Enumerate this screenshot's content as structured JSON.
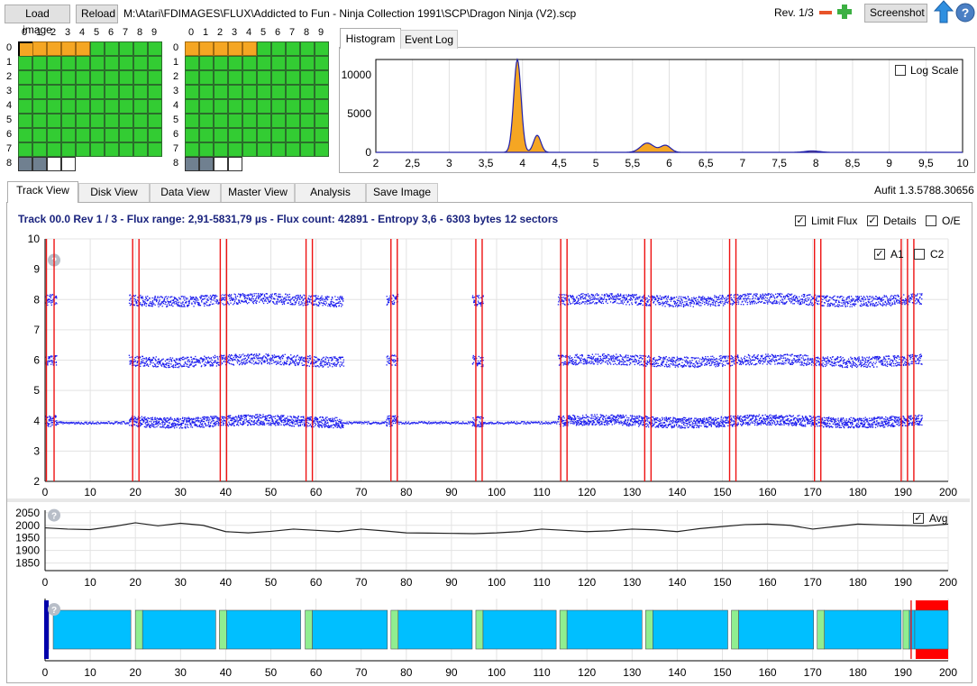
{
  "toolbar": {
    "load_label": "Load image",
    "reload_label": "Reload",
    "file_path": "M:\\Atari\\FDIMAGES\\FLUX\\Addicted to Fun - Ninja Collection 1991\\SCP\\Dragon Ninja (V2).scp",
    "rev_label": "Rev. 1/3",
    "minus_icon": "minus-icon",
    "plus_icon": "plus-icon",
    "screenshot_label": "Screenshot",
    "up_icon": "up-arrow-icon",
    "help_icon": "help-icon"
  },
  "track_grids": {
    "col_labels": [
      "0",
      "1",
      "2",
      "3",
      "4",
      "5",
      "6",
      "7",
      "8",
      "9"
    ],
    "row_labels": [
      "0",
      "1",
      "2",
      "3",
      "4",
      "5",
      "6",
      "7",
      "8"
    ],
    "colors": {
      "good": "#33cc33",
      "partial": "#f5a623",
      "unknown": "#708090",
      "empty": "#ffffff"
    },
    "side0": [
      [
        "partial",
        "partial",
        "partial",
        "partial",
        "partial",
        "good",
        "good",
        "good",
        "good",
        "good"
      ],
      [
        "good",
        "good",
        "good",
        "good",
        "good",
        "good",
        "good",
        "good",
        "good",
        "good"
      ],
      [
        "good",
        "good",
        "good",
        "good",
        "good",
        "good",
        "good",
        "good",
        "good",
        "good"
      ],
      [
        "good",
        "good",
        "good",
        "good",
        "good",
        "good",
        "good",
        "good",
        "good",
        "good"
      ],
      [
        "good",
        "good",
        "good",
        "good",
        "good",
        "good",
        "good",
        "good",
        "good",
        "good"
      ],
      [
        "good",
        "good",
        "good",
        "good",
        "good",
        "good",
        "good",
        "good",
        "good",
        "good"
      ],
      [
        "good",
        "good",
        "good",
        "good",
        "good",
        "good",
        "good",
        "good",
        "good",
        "good"
      ],
      [
        "good",
        "good",
        "good",
        "good",
        "good",
        "good",
        "good",
        "good",
        "good",
        "good"
      ],
      [
        "unknown",
        "unknown",
        "empty",
        "empty"
      ]
    ],
    "side1": [
      [
        "partial",
        "partial",
        "partial",
        "partial",
        "partial",
        "good",
        "good",
        "good",
        "good",
        "good"
      ],
      [
        "good",
        "good",
        "good",
        "good",
        "good",
        "good",
        "good",
        "good",
        "good",
        "good"
      ],
      [
        "good",
        "good",
        "good",
        "good",
        "good",
        "good",
        "good",
        "good",
        "good",
        "good"
      ],
      [
        "good",
        "good",
        "good",
        "good",
        "good",
        "good",
        "good",
        "good",
        "good",
        "good"
      ],
      [
        "good",
        "good",
        "good",
        "good",
        "good",
        "good",
        "good",
        "good",
        "good",
        "good"
      ],
      [
        "good",
        "good",
        "good",
        "good",
        "good",
        "good",
        "good",
        "good",
        "good",
        "good"
      ],
      [
        "good",
        "good",
        "good",
        "good",
        "good",
        "good",
        "good",
        "good",
        "good",
        "good"
      ],
      [
        "good",
        "good",
        "good",
        "good",
        "good",
        "good",
        "good",
        "good",
        "good",
        "good"
      ],
      [
        "unknown",
        "unknown",
        "empty",
        "empty"
      ]
    ]
  },
  "histogram_panel": {
    "tabs": [
      "Histogram",
      "Event Log"
    ],
    "log_scale_label": "Log Scale",
    "log_scale_checked": false
  },
  "main_tabs": [
    "Track View",
    "Disk View",
    "Data View",
    "Master View",
    "Analysis",
    "Save Image"
  ],
  "version": "Aufit 1.3.5788.30656",
  "track_info": "Track 00.0 Rev 1 / 3 - Flux range: 2,91-5831,79 µs - Flux count: 42891 - Entropy 3,6 - 6303 bytes 12 sectors",
  "options": {
    "limit_flux_label": "Limit Flux",
    "limit_flux_checked": true,
    "details_label": "Details",
    "details_checked": true,
    "oe_label": "O/E",
    "oe_checked": false,
    "a1_label": "A1",
    "a1_checked": true,
    "c2_label": "C2",
    "c2_checked": false,
    "avg_label": "Avg",
    "avg_checked": true
  },
  "chart_data": [
    {
      "type": "area",
      "name": "histogram",
      "x_ticks": [
        "2",
        "2,5",
        "3",
        "3,5",
        "4",
        "4,5",
        "5",
        "5,5",
        "6",
        "6,5",
        "7",
        "7,5",
        "8",
        "8,5",
        "9",
        "9,5",
        "10"
      ],
      "y_ticks": [
        "0",
        "5000",
        "10000"
      ],
      "xlim": [
        2,
        10
      ],
      "ylim": [
        0,
        12000
      ],
      "peaks": [
        {
          "x": 3.93,
          "y": 12000,
          "width": 0.05
        },
        {
          "x": 4.2,
          "y": 2200,
          "width": 0.05
        },
        {
          "x": 5.7,
          "y": 1200,
          "width": 0.09
        },
        {
          "x": 5.95,
          "y": 900,
          "width": 0.07
        },
        {
          "x": 7.95,
          "y": 180,
          "width": 0.1
        }
      ],
      "fill_color": "#f5a623",
      "line_color": "#2222aa"
    },
    {
      "type": "scatter",
      "name": "flux-track",
      "xlim": [
        0,
        200
      ],
      "ylim": [
        2,
        10
      ],
      "x_ticks": [
        "0",
        "10",
        "20",
        "30",
        "40",
        "50",
        "60",
        "70",
        "80",
        "90",
        "100",
        "110",
        "120",
        "130",
        "140",
        "150",
        "160",
        "170",
        "180",
        "190",
        "200"
      ],
      "y_ticks": [
        "2",
        "3",
        "4",
        "5",
        "6",
        "7",
        "8",
        "9",
        "10"
      ],
      "marker_lines": [
        0.3,
        2.0,
        19.4,
        20.8,
        38.8,
        40.2,
        57.8,
        59.2,
        76.6,
        78.0,
        95.4,
        96.8,
        114.2,
        115.6,
        132.8,
        134.2,
        151.6,
        153.0,
        170.4,
        171.8,
        189.6,
        191.0,
        192.4
      ],
      "sectors": [
        [
          -1,
          2.5
        ],
        [
          18.5,
          66
        ],
        [
          75.5,
          78
        ],
        [
          94.5,
          97
        ],
        [
          113.5,
          194
        ]
      ],
      "gap_bands": [
        [
          2.5,
          18.5
        ],
        [
          66,
          75.5
        ],
        [
          78,
          94.5
        ],
        [
          97,
          113.5
        ]
      ],
      "levels": [
        4.0,
        6.0,
        8.0
      ]
    },
    {
      "type": "line",
      "name": "rpm-average",
      "xlim": [
        0,
        200
      ],
      "ylim": [
        1820,
        2060
      ],
      "y_ticks": [
        "1850",
        "1900",
        "1950",
        "2000",
        "2050"
      ],
      "x_ticks": [
        "0",
        "10",
        "20",
        "30",
        "40",
        "50",
        "60",
        "70",
        "80",
        "90",
        "100",
        "110",
        "120",
        "130",
        "140",
        "150",
        "160",
        "170",
        "180",
        "190",
        "200"
      ],
      "x": [
        0,
        5,
        10,
        15,
        20,
        25,
        30,
        35,
        40,
        45,
        50,
        55,
        60,
        65,
        70,
        75,
        80,
        85,
        90,
        95,
        100,
        105,
        110,
        115,
        120,
        125,
        130,
        135,
        140,
        145,
        150,
        155,
        160,
        165,
        170,
        175,
        180,
        185,
        190,
        195,
        200
      ],
      "y": [
        1990,
        1985,
        1983,
        1995,
        2010,
        1998,
        2008,
        2000,
        1975,
        1970,
        1976,
        1985,
        1980,
        1975,
        1985,
        1978,
        1970,
        1969,
        1968,
        1967,
        1970,
        1975,
        1985,
        1980,
        1975,
        1978,
        1985,
        1982,
        1975,
        1987,
        1995,
        2003,
        2005,
        2000,
        1985,
        1995,
        2005,
        2002,
        2000,
        1998,
        2005
      ]
    },
    {
      "type": "bar",
      "name": "sector-map",
      "xlim": [
        0,
        200
      ],
      "x_ticks": [
        "0",
        "10",
        "20",
        "30",
        "40",
        "50",
        "60",
        "70",
        "80",
        "90",
        "100",
        "110",
        "120",
        "130",
        "140",
        "150",
        "160",
        "170",
        "180",
        "190",
        "200"
      ],
      "blocks": [
        {
          "start": 0,
          "end": 0.8,
          "kind": "header"
        },
        {
          "start": 1.8,
          "end": 19.0,
          "kind": "data"
        },
        {
          "start": 20.0,
          "end": 21.6,
          "kind": "header"
        },
        {
          "start": 21.6,
          "end": 37.8,
          "kind": "data"
        },
        {
          "start": 38.6,
          "end": 40.2,
          "kind": "header"
        },
        {
          "start": 40.2,
          "end": 56.6,
          "kind": "data"
        },
        {
          "start": 57.6,
          "end": 59.2,
          "kind": "header"
        },
        {
          "start": 59.2,
          "end": 75.8,
          "kind": "data"
        },
        {
          "start": 76.6,
          "end": 78.2,
          "kind": "header"
        },
        {
          "start": 78.2,
          "end": 94.6,
          "kind": "data"
        },
        {
          "start": 95.4,
          "end": 97.0,
          "kind": "header"
        },
        {
          "start": 97.0,
          "end": 113.2,
          "kind": "data"
        },
        {
          "start": 114.0,
          "end": 115.6,
          "kind": "header"
        },
        {
          "start": 115.6,
          "end": 132.2,
          "kind": "data"
        },
        {
          "start": 133.0,
          "end": 134.6,
          "kind": "header"
        },
        {
          "start": 134.6,
          "end": 151.2,
          "kind": "data"
        },
        {
          "start": 152.0,
          "end": 153.6,
          "kind": "header"
        },
        {
          "start": 153.6,
          "end": 170.2,
          "kind": "data"
        },
        {
          "start": 171.0,
          "end": 172.6,
          "kind": "header"
        },
        {
          "start": 172.6,
          "end": 189.6,
          "kind": "data"
        },
        {
          "start": 190.0,
          "end": 191.4,
          "kind": "header"
        },
        {
          "start": 191.4,
          "end": 192.6,
          "kind": "data"
        },
        {
          "start": 192.6,
          "end": 200.5,
          "kind": "data"
        }
      ],
      "red_band": [
        192.8,
        200.5
      ],
      "colors": {
        "data": "#00bfff",
        "header": "#90ee90",
        "red": "#ff0000",
        "start": "#0000aa"
      }
    }
  ]
}
